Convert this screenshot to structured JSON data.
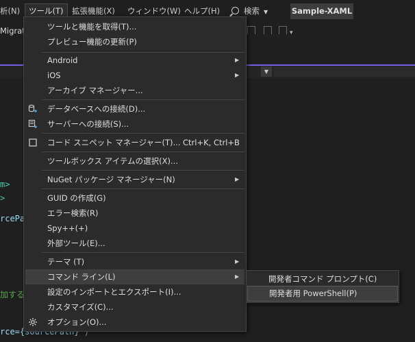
{
  "menubar": {
    "items": [
      {
        "label": "析(N)"
      },
      {
        "label": "ツール(T)"
      },
      {
        "label": "拡張機能(X)"
      },
      {
        "label": "ウィンドウ(W)"
      },
      {
        "label": "ヘルプ(H)"
      }
    ],
    "search_label": "検索",
    "solution_name": "Sample-XAML"
  },
  "toolbar": {
    "left_text": "Migrat"
  },
  "code": {
    "line1": "m>",
    "line2": ">",
    "line3": "rcePat",
    "line4": "加する",
    "line5_a": "rce=",
    "line5_b": "{sourcePath}",
    "line5_c": "\")"
  },
  "tools_menu": {
    "items": [
      {
        "label": "ツールと機能を取得(T)..."
      },
      {
        "label": "プレビュー機能の更新(P)"
      },
      {
        "label": "Android"
      },
      {
        "label": "iOS"
      },
      {
        "label": "アーカイブ マネージャー..."
      },
      {
        "label": "データベースへの接続(D)..."
      },
      {
        "label": "サーバーへの接続(S)..."
      },
      {
        "label": "コード スニペット マネージャー(T)...",
        "shortcut": "Ctrl+K, Ctrl+B"
      },
      {
        "label": "ツールボックス アイテムの選択(X)..."
      },
      {
        "label": "NuGet パッケージ マネージャー(N)"
      },
      {
        "label": "GUID の作成(G)"
      },
      {
        "label": "エラー検索(R)"
      },
      {
        "label": "Spy++(+)"
      },
      {
        "label": "外部ツール(E)..."
      },
      {
        "label": "テーマ (T)"
      },
      {
        "label": "コマンド ライン(L)"
      },
      {
        "label": "設定のインポートとエクスポート(I)..."
      },
      {
        "label": "カスタマイズ(C)..."
      },
      {
        "label": "オプション(O)..."
      }
    ]
  },
  "command_line_submenu": {
    "items": [
      {
        "label": "開発者コマンド プロンプト(C)"
      },
      {
        "label": "開発者用 PowerShell(P)"
      }
    ]
  },
  "colors": {
    "accent": "#7160e8",
    "menu_bg": "#2b2b2b",
    "highlight_bg": "#3e3e3e"
  }
}
